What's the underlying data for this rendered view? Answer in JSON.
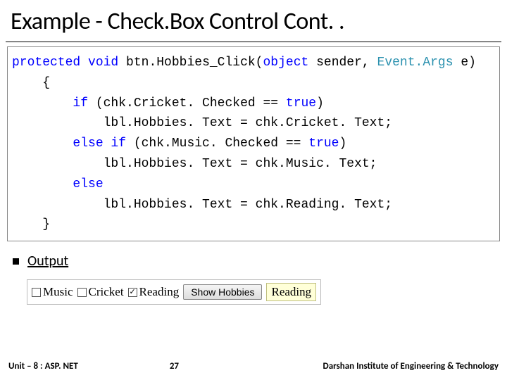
{
  "title": "Example - Check.Box Control Cont. .",
  "code": {
    "l1_kw1": "protected",
    "l1_kw2": "void",
    "l1_mid": " btn.Hobbies_Click(",
    "l1_kw3": "object",
    "l1_sp": " sender, ",
    "l1_type": "Event.Args",
    "l1_end": " e)",
    "l2": "    {",
    "l3_a": "        if",
    "l3_b": " (chk.Cricket. Checked == ",
    "l3_c": "true",
    "l3_d": ")",
    "l4": "            lbl.Hobbies. Text = chk.Cricket. Text;",
    "l5_a": "        else if",
    "l5_b": " (chk.Music. Checked == ",
    "l5_c": "true",
    "l5_d": ")",
    "l6": "            lbl.Hobbies. Text = chk.Music. Text;",
    "l7": "        else",
    "l8": "            lbl.Hobbies. Text = chk.Reading. Text;",
    "l9": "    }"
  },
  "output_label": "Output",
  "demo": {
    "chk1": "Music",
    "chk2": "Cricket",
    "chk3": "Reading",
    "chk3_check": "✓",
    "button": "Show Hobbies",
    "result": "Reading"
  },
  "footer": {
    "left": "Unit – 8 : ASP. NET",
    "page": "27",
    "right": "Darshan Institute of Engineering & Technology"
  }
}
